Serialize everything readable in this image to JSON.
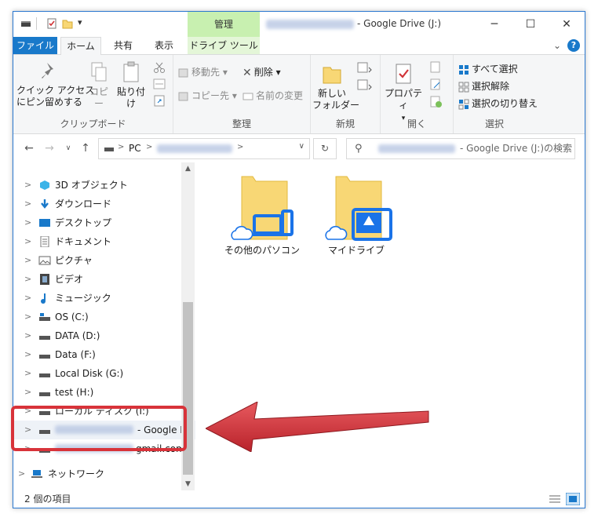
{
  "window": {
    "title_suffix": "- Google Drive (J:)",
    "controls": {
      "minimize": "─",
      "maximize": "☐",
      "close": "✕"
    }
  },
  "quick_access": {
    "overflow": "▾"
  },
  "ribbon_tabs": {
    "file": "ファイル",
    "home": "ホーム",
    "share": "共有",
    "view": "表示",
    "drive_tools": "ドライブ ツール",
    "context_header": "管理",
    "expand": "⌄",
    "help": "?"
  },
  "ribbon": {
    "clipboard": {
      "label": "クリップボード",
      "pin": "クイック アクセス\nにピン留めする",
      "copy": "コピー",
      "paste": "貼り付け"
    },
    "organize": {
      "label": "整理",
      "move_to": "移動先",
      "copy_to": "コピー先",
      "delete": "削除",
      "rename": "名前の変更"
    },
    "new": {
      "label": "新規",
      "new_folder": "新しい\nフォルダー"
    },
    "open": {
      "label": "開く",
      "properties": "プロパティ"
    },
    "select": {
      "label": "選択",
      "select_all": "すべて選択",
      "select_none": "選択解除",
      "invert": "選択の切り替え"
    }
  },
  "address": {
    "pc": "PC",
    "sep": ">",
    "search_placeholder_suffix": "- Google Drive (J:)の検索"
  },
  "nav": {
    "items": [
      {
        "label": "3D オブジェクト",
        "icon": "cube-icon"
      },
      {
        "label": "ダウンロード",
        "icon": "download-icon"
      },
      {
        "label": "デスクトップ",
        "icon": "desktop-icon"
      },
      {
        "label": "ドキュメント",
        "icon": "document-icon"
      },
      {
        "label": "ピクチャ",
        "icon": "picture-icon"
      },
      {
        "label": "ビデオ",
        "icon": "video-icon"
      },
      {
        "label": "ミュージック",
        "icon": "music-icon"
      },
      {
        "label": "OS (C:)",
        "icon": "drive-icon"
      },
      {
        "label": "DATA (D:)",
        "icon": "drive-icon"
      },
      {
        "label": "Data (F:)",
        "icon": "drive-icon"
      },
      {
        "label": "Local Disk (G:)",
        "icon": "drive-icon"
      },
      {
        "label": "test (H:)",
        "icon": "drive-icon"
      },
      {
        "label": "ローカル ディスク (I:)",
        "icon": "drive-icon"
      },
      {
        "label": "- Google D",
        "icon": "drive-icon"
      },
      {
        "label": "gmail.com",
        "icon": "drive-icon"
      },
      {
        "label": "ネットワーク",
        "icon": "network-icon"
      }
    ]
  },
  "files": [
    {
      "label": "その他のパソコン",
      "overlay": "computers-icon"
    },
    {
      "label": "マイドライブ",
      "overlay": "drive-logo-icon"
    }
  ],
  "status": {
    "count": "2 個の項目"
  },
  "colors": {
    "accent": "#1979ca",
    "context_tab": "#c8f0b0",
    "highlight": "#d8333a",
    "folder": "#f8d775"
  }
}
